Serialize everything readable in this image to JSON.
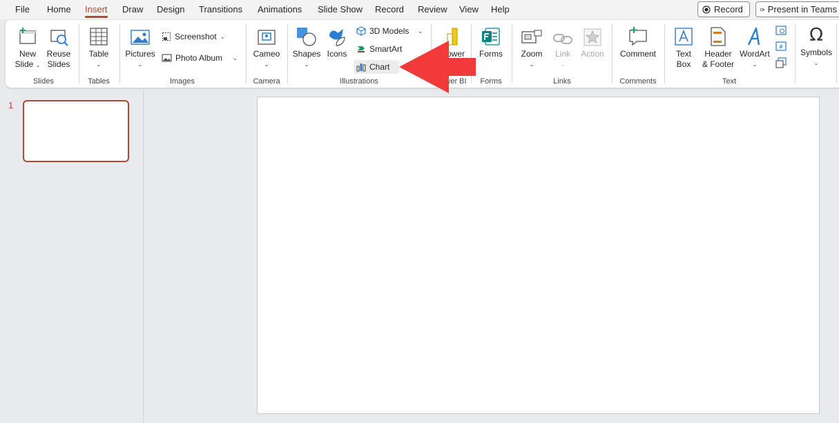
{
  "menu": {
    "tabs": [
      "File",
      "Home",
      "Insert",
      "Draw",
      "Design",
      "Transitions",
      "Animations",
      "Slide Show",
      "Record",
      "Review",
      "View",
      "Help"
    ],
    "active_tab": "Insert",
    "record_button": "Record",
    "present_button": "Present in Teams"
  },
  "ribbon": {
    "slides": {
      "new_slide": [
        "New",
        "Slide"
      ],
      "reuse_slides": [
        "Reuse",
        "Slides"
      ],
      "label": "Slides"
    },
    "tables": {
      "table": "Table",
      "label": "Tables"
    },
    "images": {
      "pictures": "Pictures",
      "screenshot": "Screenshot",
      "photo_album": "Photo Album",
      "label": "Images"
    },
    "camera": {
      "cameo": "Cameo",
      "label": "Camera"
    },
    "illustrations": {
      "shapes": "Shapes",
      "icons": "Icons",
      "models": "3D Models",
      "smartart": "SmartArt",
      "chart": "Chart",
      "label": "Illustrations"
    },
    "powerbi": {
      "power": "ower",
      "label": "wer BI"
    },
    "forms": {
      "forms": "Forms",
      "label": "Forms"
    },
    "links": {
      "zoom": "Zoom",
      "link": "Link",
      "action": "Action",
      "label": "Links"
    },
    "comments": {
      "comment": "Comment",
      "label": "Comments"
    },
    "text": {
      "text_box": [
        "Text",
        "Box"
      ],
      "header_footer": [
        "Header",
        "& Footer"
      ],
      "wordart": "WordArt",
      "label": "Text"
    },
    "symbols": {
      "symbols": "Symbols"
    }
  },
  "thumbnails": {
    "number": "1"
  },
  "colors": {
    "accent": "#b7472a",
    "arrow": "#f23a3a",
    "icon_blue": "#2b7cd3"
  }
}
